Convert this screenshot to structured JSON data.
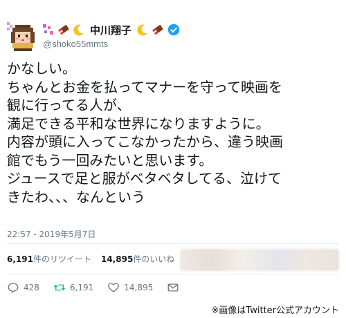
{
  "user": {
    "display_name": "中川翔子",
    "handle": "@shoko55mmts",
    "avatar_icon": "pixel-art-avatar-icon",
    "verified_icon": "verified-badge-icon",
    "name_emojis": [
      "sparkle-icon",
      "chocolate-icon",
      "crescent-moon-icon",
      "crescent-moon-icon",
      "chocolate-icon"
    ]
  },
  "tweet": {
    "lines": [
      "かなしい。",
      "ちゃんとお金を払ってマナーを守って映画を",
      "観に行ってる人が、",
      "満足できる平和な世界になりますように。",
      "内容が頭に入ってこなかったから、違う映画",
      "館でもう一回みたいと思います。",
      "ジュースで足と服がベタベタしてる、泣けて",
      "きたわ、、、なんという"
    ],
    "timestamp": "22:57 - 2019年5月7日"
  },
  "stats": {
    "retweets_count": "6,191",
    "retweets_label": "件のリツイート",
    "likes_count": "14,895",
    "likes_label": "件のいいね"
  },
  "actions": {
    "reply_count": "428",
    "retweet_count": "6,191",
    "like_count": "14,895"
  },
  "credit": "※画像はTwitter公式アカウント",
  "colors": {
    "verified": "#1da1f2",
    "muted": "#657786",
    "text": "#14171a",
    "divider": "#e6ecf0"
  }
}
